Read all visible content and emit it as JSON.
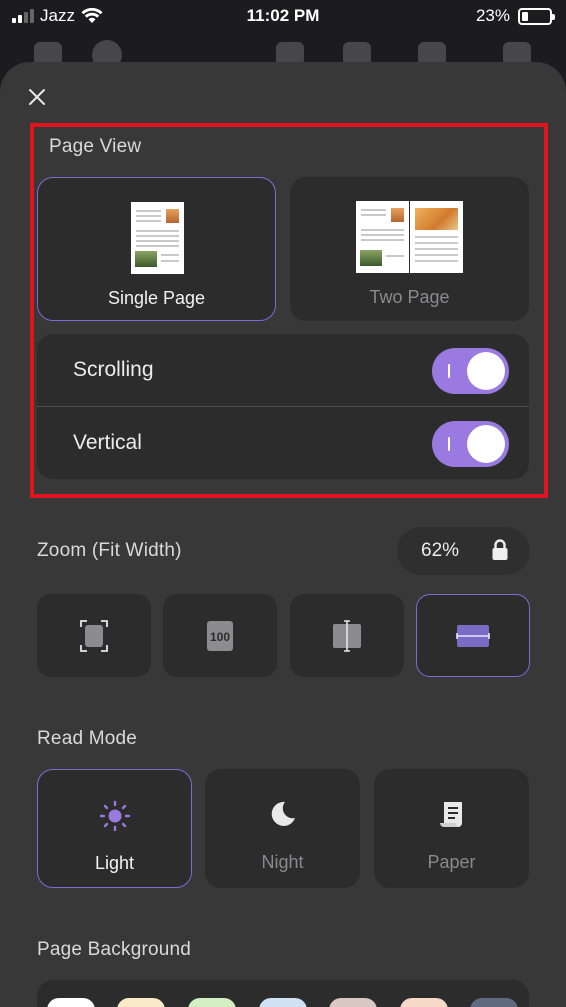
{
  "status_bar": {
    "carrier": "Jazz",
    "time": "11:02 PM",
    "battery_percent": "23%",
    "battery_level": 0.23
  },
  "icons": {
    "close": "close-icon",
    "wifi": "wifi-icon",
    "lock": "lock-icon",
    "light": "sun-icon",
    "night": "moon-icon",
    "paper": "scroll-icon"
  },
  "page_view": {
    "title": "Page View",
    "single_page": {
      "label": "Single Page",
      "selected": true
    },
    "two_page": {
      "label": "Two Page",
      "selected": false
    },
    "scrolling": {
      "label": "Scrolling",
      "on": true
    },
    "vertical": {
      "label": "Vertical",
      "on": true
    }
  },
  "zoom": {
    "title": "Zoom (Fit Width)",
    "value": "62%",
    "modes": [
      {
        "name": "fit-page",
        "selected": false
      },
      {
        "name": "actual-size",
        "selected": false,
        "text": "100"
      },
      {
        "name": "fit-height",
        "selected": false
      },
      {
        "name": "fit-width",
        "selected": true
      }
    ]
  },
  "read_mode": {
    "title": "Read Mode",
    "modes": [
      {
        "label": "Light",
        "selected": true
      },
      {
        "label": "Night",
        "selected": false
      },
      {
        "label": "Paper",
        "selected": false
      }
    ]
  },
  "page_background": {
    "title": "Page Background",
    "swatches": [
      "#ffffff",
      "#fbeac8",
      "#d3f0c2",
      "#cfe2f3",
      "#d9c7c3",
      "#f6d9c7",
      "#5f6a80"
    ]
  },
  "colors": {
    "accent": "#9a7ae0",
    "highlight_border": "#e0141e",
    "sheet": "#383839",
    "card": "#2c2c2d"
  }
}
